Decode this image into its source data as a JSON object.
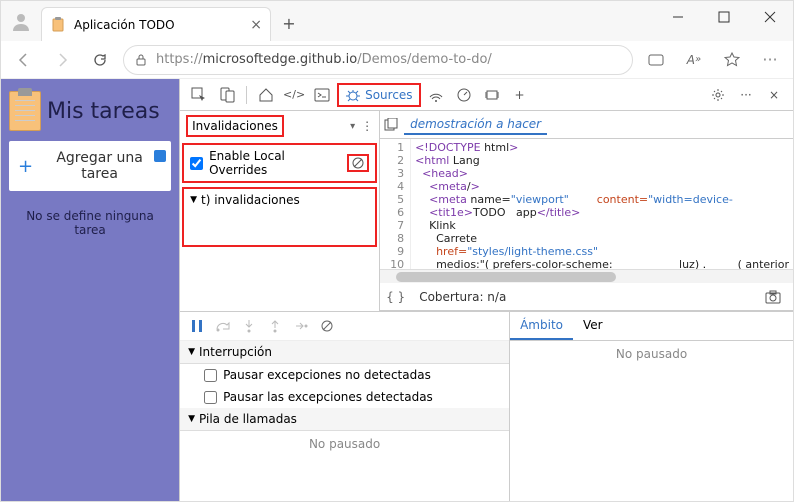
{
  "browser": {
    "tab_title": "Aplicación TODO",
    "url_host": "microsoftedge.github.io",
    "url_prefix": "https://",
    "url_path": "/Demos/demo-to-do/"
  },
  "page": {
    "title": "Mis tareas",
    "add_button": "Agregar una tarea",
    "empty_msg": "No se define ninguna tarea"
  },
  "devtools": {
    "active_tab": "Sources",
    "nav": {
      "dropdown_label": "Invalidaciones",
      "overrides_checkbox": "Enable Local Overrides",
      "tree_root": "t) invalidaciones"
    },
    "editor": {
      "tab_label": "demostración a hacer",
      "lines": [
        {
          "n": 1,
          "html": "<span class='kw'>&lt;!DOCTYPE</span> <span class='txt'>html</span><span class='kw'>&gt;</span>"
        },
        {
          "n": 2,
          "html": "<span class='kw'>&lt;html</span><span class='txt'> Lang</span>"
        },
        {
          "n": 3,
          "html": "  <span class='kw'>&lt;head&gt;</span>"
        },
        {
          "n": 4,
          "html": "    <span class='kw'>&lt;meta</span><span class='txt'>/</span><span class='kw'>&gt;</span>"
        },
        {
          "n": 5,
          "html": "    <span class='kw'>&lt;meta</span> <span class='txt'>name=</span><span class='str'>\"viewport\"</span>        <span class='attr'>content=</span><span class='str'>\"width=device-</span>"
        },
        {
          "n": 6,
          "html": "    <span class='kw'>&lt;tit1e&gt;</span><span class='txt'>TODO   app</span><span class='kw'>&lt;/title&gt;</span>"
        },
        {
          "n": 7,
          "html": "    <span class='txt'>Klink</span>"
        },
        {
          "n": 8,
          "html": "      <span class='txt'>Carrete</span>"
        },
        {
          "n": 9,
          "html": "      <span class='attr'>href=</span><span class='str'>\"styles/light-theme.css\"</span>"
        },
        {
          "n": 10,
          "html": "      <span class='txt'>medios:\"</span><span class='txt'>( prefers-color-scheme:</span>                   <span class='txt'>luz)</span> .         <span class='txt'>( anterior</span>"
        }
      ]
    },
    "coverage_label": "Cobertura: n/a",
    "debugger": {
      "section_breakpoints": "Interrupción",
      "cb_uncaught": "Pausar excepciones no detectadas",
      "cb_caught": "Pausar las excepciones detectadas",
      "section_callstack": "Pila de llamadas",
      "not_paused": "No pausado"
    },
    "scope": {
      "tab_scope": "Ámbito",
      "tab_watch": "Ver",
      "not_paused": "No pausado"
    }
  }
}
